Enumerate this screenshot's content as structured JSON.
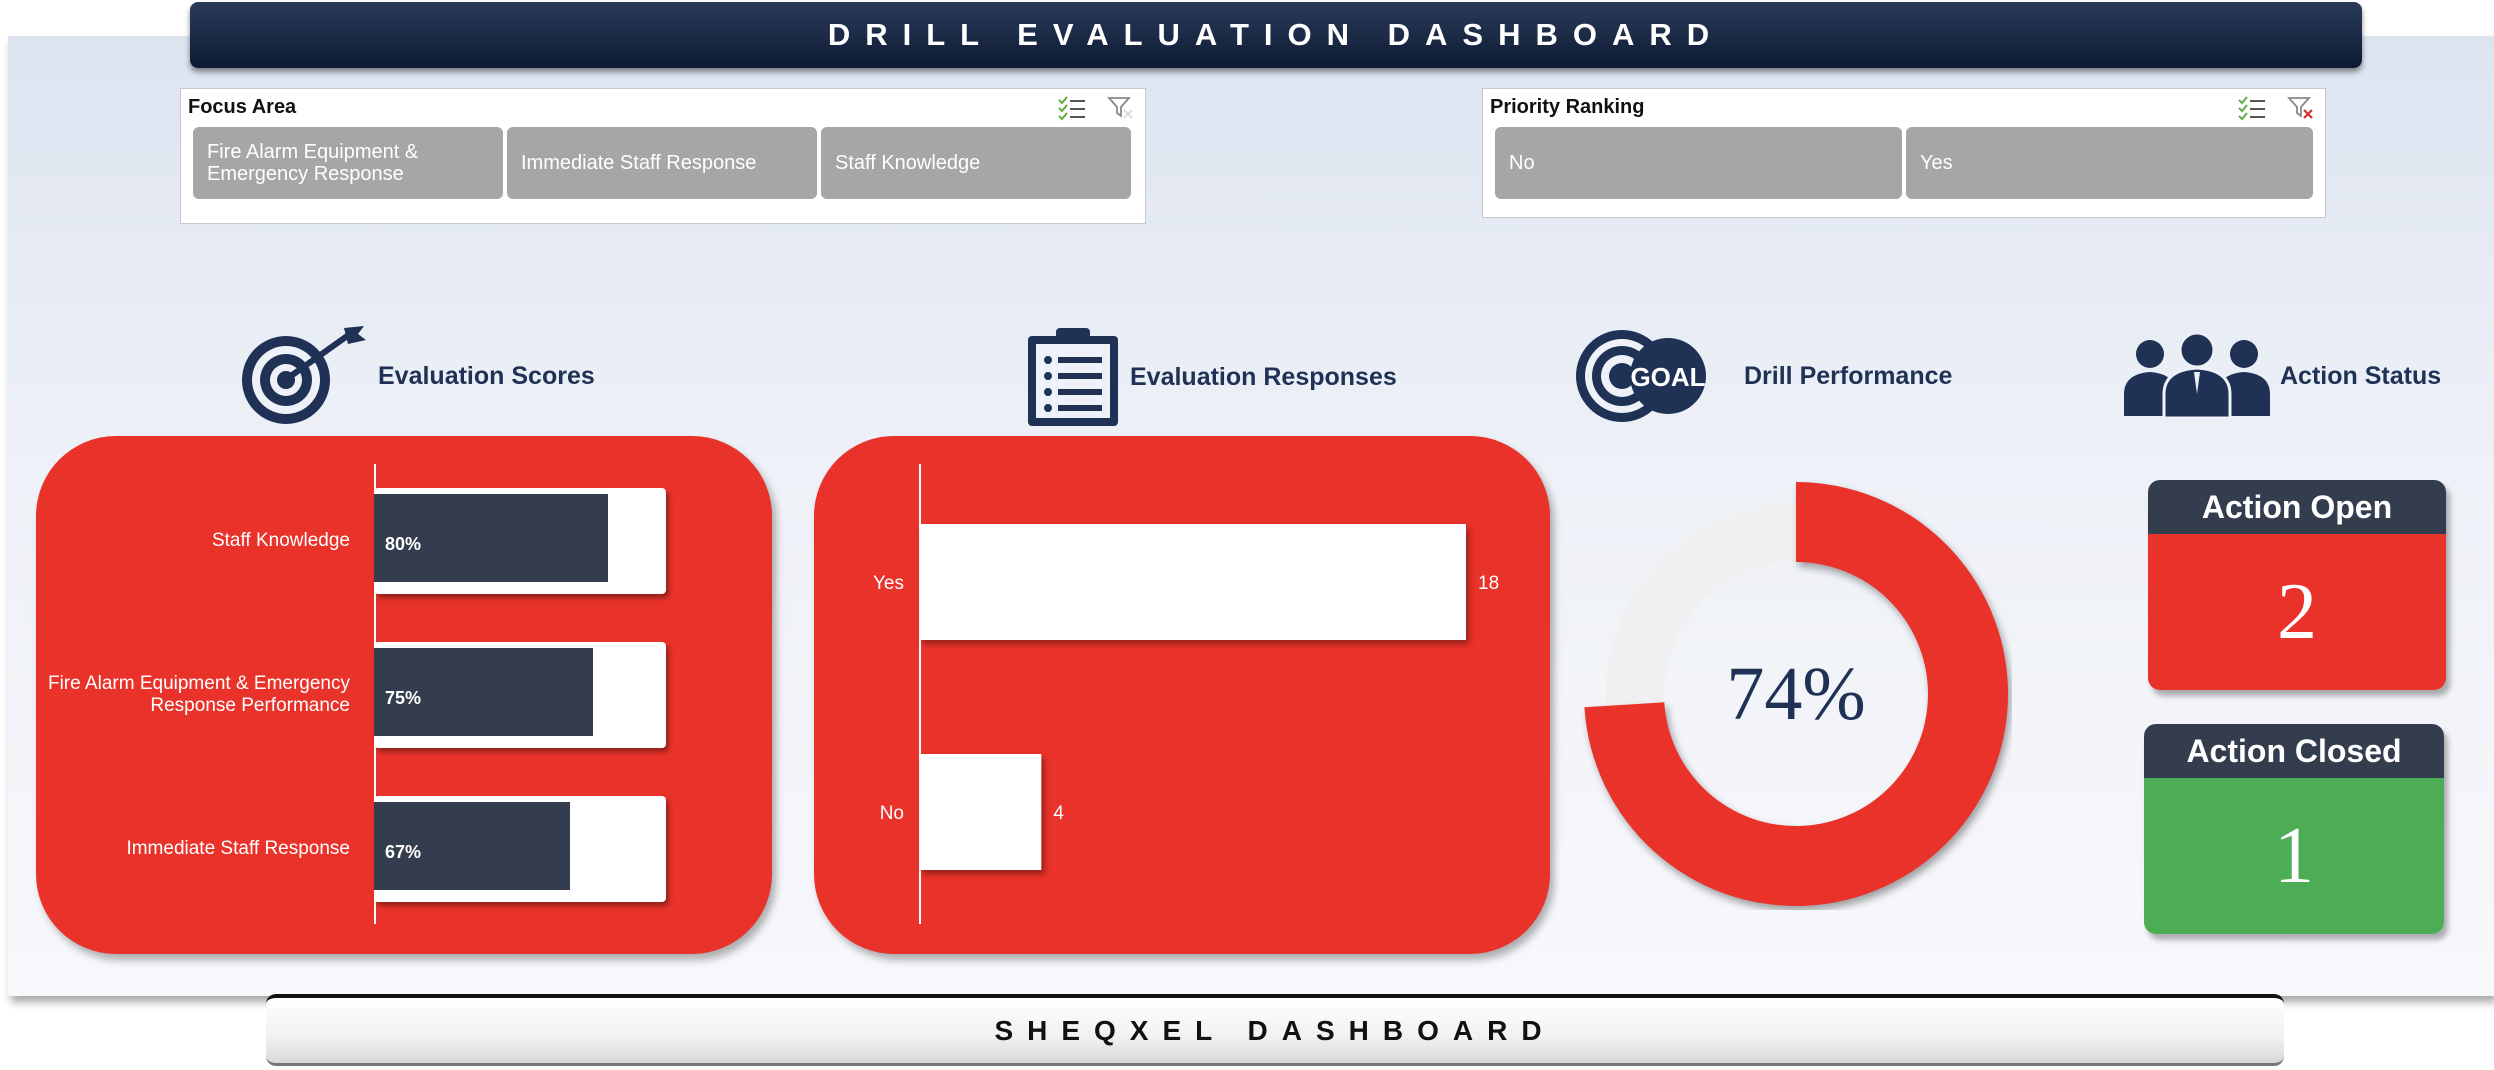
{
  "header": {
    "title": "DRILL EVALUATION DASHBOARD"
  },
  "footer": {
    "title": "SHEQXEL DASHBOARD"
  },
  "filters": {
    "focus_area": {
      "title": "Focus Area",
      "options": [
        "Fire Alarm Equipment & Emergency Response",
        "Immediate Staff Response",
        "Staff Knowledge"
      ]
    },
    "priority_ranking": {
      "title": "Priority Ranking",
      "options": [
        "No",
        "Yes"
      ]
    }
  },
  "sections": {
    "scores": "Evaluation Scores",
    "responses": "Evaluation Responses",
    "performance": "Drill Performance",
    "actions": "Action Status"
  },
  "icons": {
    "scores": "target-arrow-icon",
    "responses": "clipboard-list-icon",
    "performance": "goal-target-icon",
    "actions": "team-people-icon"
  },
  "chart_data": [
    {
      "type": "bar",
      "orientation": "horizontal",
      "categories": [
        "Staff Knowledge",
        "Fire Alarm Equipment & Emergency Response Performance",
        "Immediate Staff Response"
      ],
      "values": [
        80,
        75,
        67
      ],
      "value_labels": [
        "80%",
        "75%",
        "67%"
      ],
      "xlim": [
        0,
        100
      ]
    },
    {
      "type": "bar",
      "orientation": "horizontal",
      "categories": [
        "Yes",
        "No"
      ],
      "values": [
        18,
        4
      ],
      "value_labels": [
        "18",
        "4"
      ],
      "xlim": [
        0,
        18
      ]
    },
    {
      "type": "pie",
      "style": "donut",
      "value": 74,
      "center_label": "74%"
    }
  ],
  "actions": {
    "open": {
      "label": "Action Open",
      "value": "2"
    },
    "closed": {
      "label": "Action Closed",
      "value": "1"
    }
  },
  "colors": {
    "navy": "#1f3154",
    "red": "#e8322a",
    "green": "#4cad55",
    "dark_bar": "#333d4e",
    "slicer_btn": "#a6a6a6",
    "donut_rest": "#f0f0f0"
  }
}
